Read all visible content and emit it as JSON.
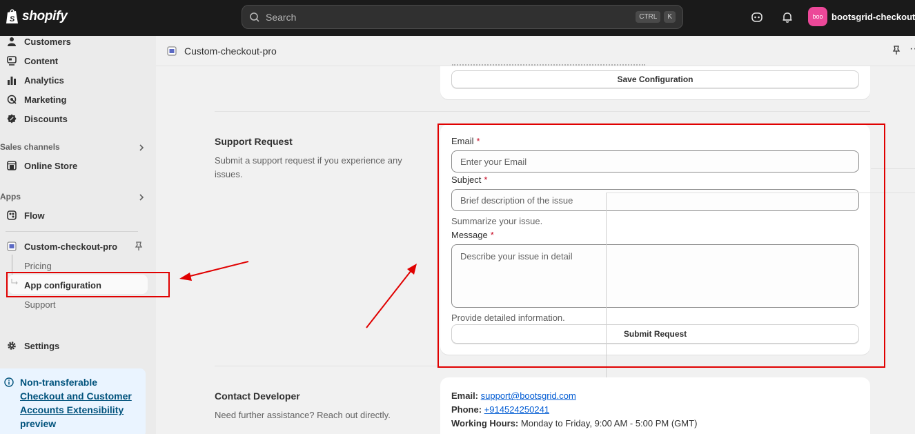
{
  "topbar": {
    "logo_text": "shopify",
    "search_placeholder": "Search",
    "shortcut_ctrl": "CTRL",
    "shortcut_k": "K",
    "store_avatar": "boo",
    "store_name": "bootsgrid-checkoutp"
  },
  "sidebar": {
    "items": [
      {
        "label": "Customers",
        "icon": "person-icon"
      },
      {
        "label": "Content",
        "icon": "content-icon"
      },
      {
        "label": "Analytics",
        "icon": "bar-chart-icon"
      },
      {
        "label": "Marketing",
        "icon": "target-icon"
      },
      {
        "label": "Discounts",
        "icon": "discount-icon"
      }
    ],
    "sales_channels_label": "Sales channels",
    "online_store_label": "Online Store",
    "apps_label": "Apps",
    "flow_label": "Flow",
    "app_name": "Custom-checkout-pro",
    "sub_items": [
      "Pricing",
      "App configuration",
      "Support"
    ],
    "settings_label": "Settings",
    "notice": {
      "title": "Non-transferable",
      "link": "Checkout and Customer Accounts Extensibility",
      "rest": "preview"
    }
  },
  "appbar": {
    "title": "Custom-checkout-pro"
  },
  "config_card": {
    "save_label": "Save Configuration"
  },
  "support": {
    "title": "Support Request",
    "description": "Submit a support request if you experience any issues.",
    "email_label": "Email",
    "email_placeholder": "Enter your Email",
    "subject_label": "Subject",
    "subject_placeholder": "Brief description of the issue",
    "subject_help": "Summarize your issue.",
    "message_label": "Message",
    "message_placeholder": "Describe your issue in detail",
    "message_help": "Provide detailed information.",
    "required_mark": "*",
    "submit_label": "Submit Request"
  },
  "contact": {
    "title": "Contact Developer",
    "description": "Need further assistance? Reach out directly.",
    "email_label": "Email:",
    "email_value": "support@bootsgrid.com",
    "phone_label": "Phone:",
    "phone_value": "+914524250241",
    "hours_label": "Working Hours:",
    "hours_value": "Monday to Friday, 9:00 AM - 5:00 PM (GMT)"
  },
  "colors": {
    "annotation": "#e00000",
    "topbar": "#1a1a1a",
    "link": "#005bd3",
    "required": "#c70a24"
  }
}
